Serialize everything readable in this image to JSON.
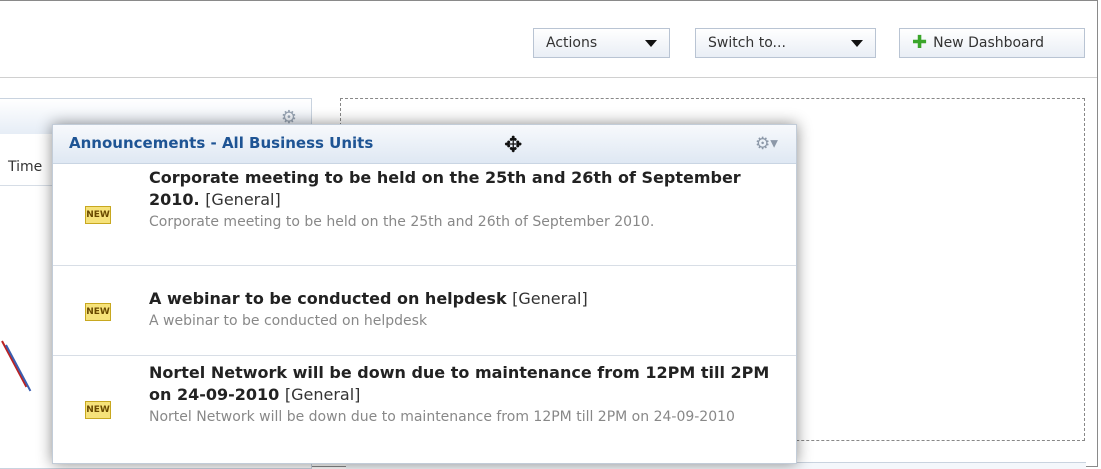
{
  "toolbar": {
    "actions_label": "Actions",
    "switch_label": "Switch to...",
    "new_dashboard_label": "New Dashboard"
  },
  "background_widget": {
    "column_fragment": "Time"
  },
  "popup": {
    "title": "Announcements - All Business Units",
    "items": [
      {
        "title": "Corporate meeting to be held on the 25th and 26th of September 2010.",
        "category": "[General]",
        "description": "Corporate meeting to be held on the 25th and 26th of September 2010."
      },
      {
        "title": "A webinar to be conducted on helpdesk",
        "category": "[General]",
        "description": "A webinar to be conducted on helpdesk"
      },
      {
        "title": "Nortel Network will be down due to maintenance from 12PM till 2PM on 24-09-2010",
        "category": "[General]",
        "description": "Nortel Network will be down due to maintenance from 12PM till 2PM on 24-09-2010"
      }
    ]
  },
  "icons": {
    "new_badge_text": "NEW"
  }
}
